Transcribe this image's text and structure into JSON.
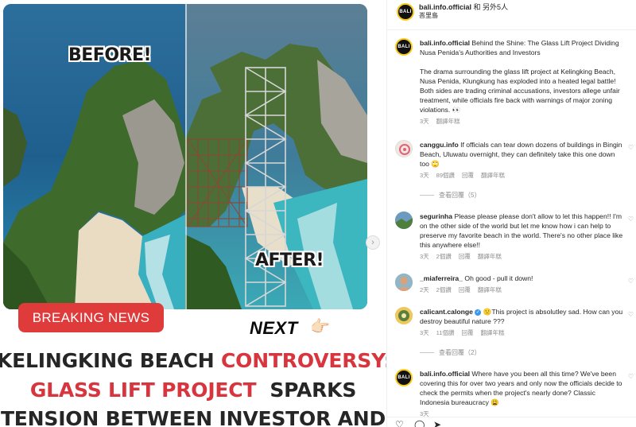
{
  "media": {
    "before_label": "BEFORE!",
    "after_label": "AFTER!",
    "breaking_label": "BREAKING NEWS",
    "next_label": "NEXT",
    "next_hand": "👉🏻",
    "carousel_arrow": "›",
    "headline": {
      "line1_a": "KELINGKING BEACH ",
      "line1_b": "CONTROVERSY",
      "line1_c": ":",
      "line2_a": "GLASS LIFT PROJECT",
      "line2_b": "  SPARKS",
      "line3": "TENSION BETWEEN INVESTOR AND"
    }
  },
  "post": {
    "account": "bali.info.official",
    "collab_text": " 和 另外5人",
    "location": "峇里島",
    "caption": {
      "user": "bali.info.official",
      "para1": " Behind the Shine: The Glass Lift Project Dividing Nusa Penida's Authorities and Investors",
      "para2": "The drama surrounding the glass lift project at Kelingking Beach, Nusa Penida, Klungkung has exploded into a heated legal battle! Both sides are trading criminal accusations, investors allege unfair treatment, while officials fire back with warnings of major zoning violations. 👀",
      "age": "3天",
      "translate": "翻譯年糕"
    }
  },
  "comments": [
    {
      "user": "canggu.info",
      "text": " If officials can tear down dozens of buildings in Bingin Beach, Uluwatu overnight, they can definitely take this one down too 🙄",
      "age": "3天",
      "likes": "89個讚",
      "reply": "回覆",
      "translate": "翻譯年糕",
      "view_replies": "查看回覆（5）"
    },
    {
      "user": "segurinha",
      "text": " Please please please don't allow to let this happen!! I'm on the other side of the world but let me know how i can help to preserve my favorite beach in the world. There's no other place like this anywhere else!!",
      "age": "3天",
      "likes": "2個讚",
      "reply": "回覆",
      "translate": "翻譯年糕"
    },
    {
      "user": "_miaferreira_",
      "text": " Oh good - pull it down!",
      "age": "2天",
      "likes": "2個讚",
      "reply": "回覆",
      "translate": "翻譯年糕"
    },
    {
      "user": "calicant.calonge",
      "verified": "✓",
      "text": " 🙁This project is absolutley sad. How can you destroy beautiful nature ???",
      "age": "3天",
      "likes": "11個讚",
      "reply": "回覆",
      "translate": "翻譯年糕",
      "view_replies": "查看回覆（2）"
    },
    {
      "user": "bali.info.official",
      "text": " Where have you been all this time? We've been covering this for over two years and only now the officials decide to check the permits when the project's nearly done? Classic Indonesia bureaucracy 😩",
      "age": "3天",
      "likes": "",
      "reply": "",
      "translate": ""
    }
  ],
  "logo_text": "BALI",
  "icons": {
    "heart": "heart-outline-icon",
    "comment": "comment-icon",
    "share": "share-icon",
    "carousel": "chevron-right-icon"
  },
  "glyphs": {
    "heart": "♡",
    "comment": "◯",
    "share": "➤"
  },
  "colors": {
    "accent_red": "#d8363f",
    "breaking_bg": "#e03b3b",
    "muted": "#8e8e8e",
    "verified": "#3897f0",
    "logo_ring": "#f9c91a"
  }
}
